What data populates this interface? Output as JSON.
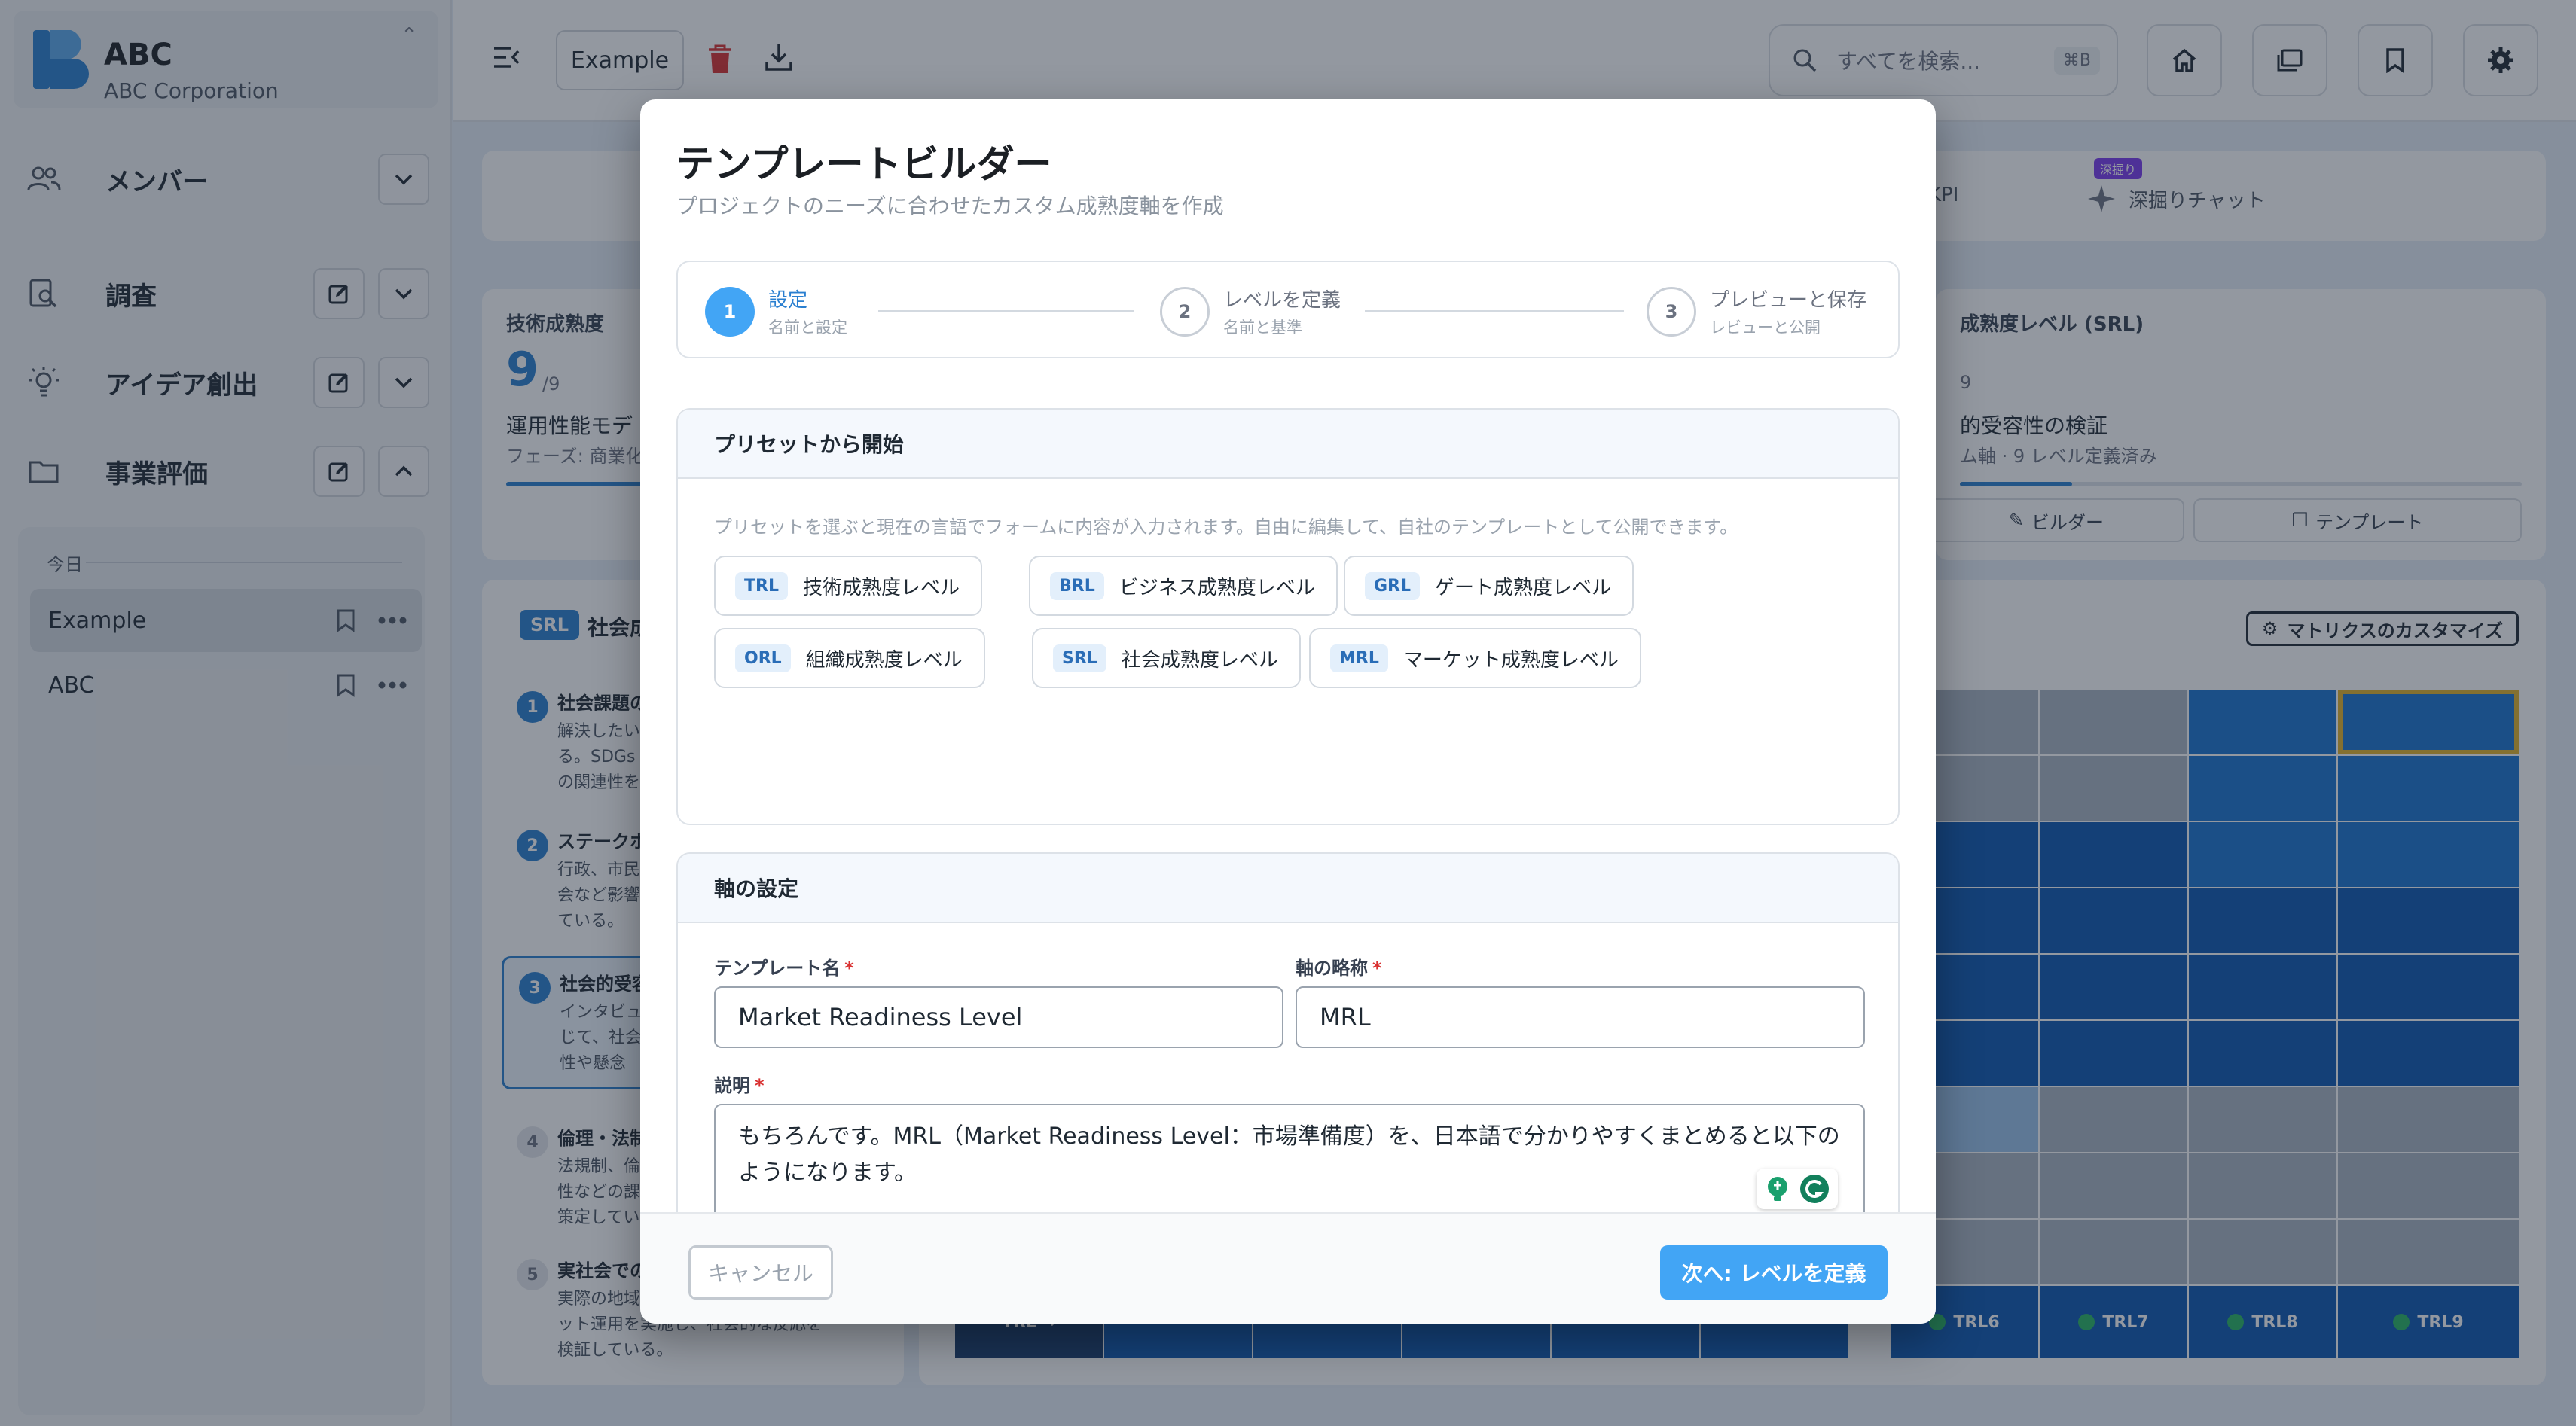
{
  "app": {
    "name": "ABC",
    "org": "ABC Corporation"
  },
  "sidebar": {
    "items": [
      {
        "label": "メンバー"
      },
      {
        "label": "調査"
      },
      {
        "label": "アイデア創出"
      },
      {
        "label": "事業評価"
      }
    ],
    "history_heading": "今日",
    "history": [
      {
        "label": "Example"
      },
      {
        "label": "ABC"
      }
    ]
  },
  "topbar": {
    "project": "Example",
    "search_placeholder": "すべてを検索...",
    "shortcut": "⌘B"
  },
  "background": {
    "tabs": {
      "kpi": "KPI",
      "chat": "深掘りチャット",
      "chat_badge": "深掘り"
    },
    "trl_card": {
      "title": "技術成熟度",
      "value": "9",
      "max": "/9",
      "line1": "運用性能モデ",
      "line2": "フェーズ: 商業化",
      "progress": 1.0
    },
    "srl_card": {
      "title": "成熟度レベル (SRL)",
      "value": "9",
      "line1": "的受容性の検証",
      "line2": "ム軸 · 9 レベル定義済み",
      "progress": 0.2,
      "btn_builder": "ビルダー",
      "btn_template": "テンプレート"
    },
    "srl_panel": {
      "chip": "SRL",
      "chip_label": "社会成",
      "steps": [
        {
          "num": "1",
          "title": "社会課題の",
          "desc": [
            "解決したい",
            "る。SDGs",
            "の関連性を"
          ]
        },
        {
          "num": "2",
          "title": "ステークホ",
          "desc": [
            "行政、市民",
            "会など影響",
            "ている。"
          ]
        },
        {
          "num": "3",
          "title": "社会的受容",
          "desc": [
            "インタビュ",
            "じて、社会",
            "性や懸念"
          ]
        },
        {
          "num": "4",
          "title": "倫理・法制",
          "desc": [
            "法規制、倫",
            "性などの課",
            "策定してい"
          ]
        },
        {
          "num": "5",
          "title": "実社会での",
          "desc": [
            "実際の地域",
            "ット運用を実施し、社会的な反応を",
            "検証している。"
          ]
        }
      ]
    },
    "matrix": {
      "customize": "マトリクスのカスタマイズ",
      "footer": [
        "TRL →",
        "",
        "",
        "",
        "",
        "",
        "TRL6",
        "TRL7",
        "TRL8",
        "TRL9"
      ]
    }
  },
  "modal": {
    "title": "テンプレートビルダー",
    "subtitle": "プロジェクトのニーズに合わせたカスタム成熟度軸を作成",
    "steps": [
      {
        "num": "1",
        "label": "設定",
        "sub": "名前と設定"
      },
      {
        "num": "2",
        "label": "レベルを定義",
        "sub": "名前と基準"
      },
      {
        "num": "3",
        "label": "プレビューと保存",
        "sub": "レビューと公開"
      }
    ],
    "preset": {
      "heading": "プリセットから開始",
      "note": "プリセットを選ぶと現在の言語でフォームに内容が入力されます。自由に編集して、自社のテンプレートとして公開できます。",
      "chips": [
        {
          "code": "TRL",
          "name": "技術成熟度レベル"
        },
        {
          "code": "BRL",
          "name": "ビジネス成熟度レベル"
        },
        {
          "code": "GRL",
          "name": "ゲート成熟度レベル"
        },
        {
          "code": "ORL",
          "name": "組織成熟度レベル"
        },
        {
          "code": "SRL",
          "name": "社会成熟度レベル"
        },
        {
          "code": "MRL",
          "name": "マーケット成熟度レベル"
        }
      ]
    },
    "axis": {
      "heading": "軸の設定",
      "template_name_label": "テンプレート名",
      "template_name_value": "Market Readiness Level",
      "abbr_label": "軸の略称",
      "abbr_value": "MRL",
      "description_label": "説明",
      "description_value": "もちろんです。MRL（Market Readiness Level：市場準備度）を、日本語で分かりやすくまとめると以下のようになります。",
      "required_mark": "*"
    },
    "footer": {
      "cancel": "キャンセル",
      "next": "次へ: レベルを定義"
    }
  }
}
